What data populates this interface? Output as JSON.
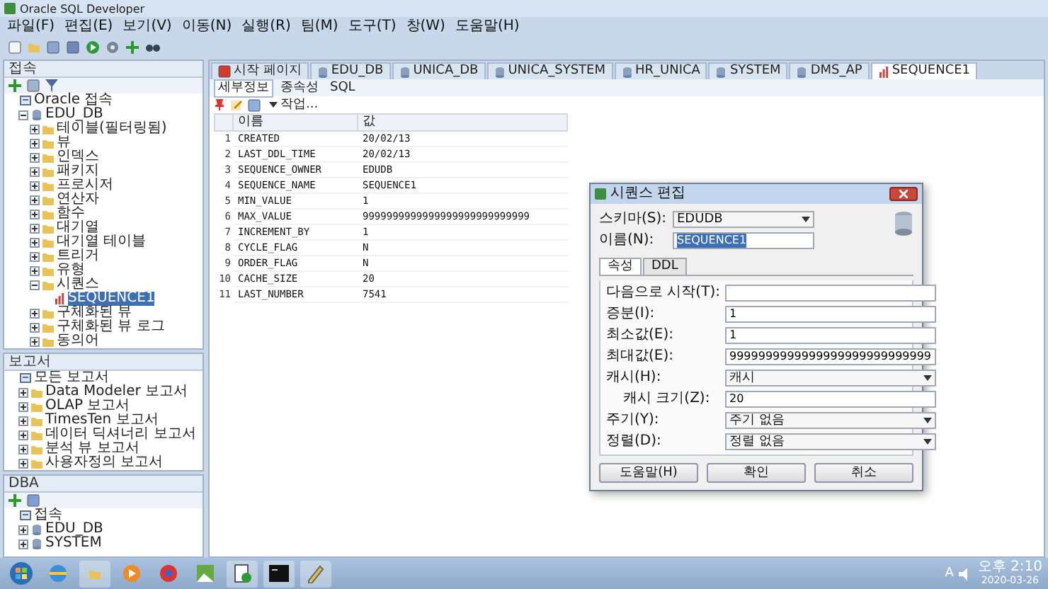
{
  "window": {
    "title": "Oracle SQL Developer"
  },
  "menu": [
    "파일(F)",
    "편집(E)",
    "보기(V)",
    "이동(N)",
    "실행(R)",
    "팀(M)",
    "도구(T)",
    "창(W)",
    "도움말(H)"
  ],
  "connections_panel": {
    "title": "접속",
    "tree": [
      {
        "label": "Oracle 접속",
        "children": [
          {
            "label": "EDU_DB",
            "expanded": true,
            "children": [
              {
                "label": "테이블(필터링됨)",
                "expanded": false
              },
              {
                "label": "뷰",
                "expanded": false
              },
              {
                "label": "인덱스",
                "expanded": false
              },
              {
                "label": "패키지",
                "expanded": false
              },
              {
                "label": "프로시저",
                "expanded": false
              },
              {
                "label": "연산자",
                "expanded": false
              },
              {
                "label": "함수",
                "expanded": false
              },
              {
                "label": "대기열",
                "expanded": false
              },
              {
                "label": "대기열 테이블",
                "expanded": false
              },
              {
                "label": "트리거",
                "expanded": false
              },
              {
                "label": "유형",
                "expanded": false
              },
              {
                "label": "시퀀스",
                "expanded": true,
                "children": [
                  {
                    "label": "SEQUENCE1",
                    "selected": true
                  }
                ]
              },
              {
                "label": "구체화된 뷰",
                "expanded": false
              },
              {
                "label": "구체화된 뷰 로그",
                "expanded": false
              },
              {
                "label": "동의어",
                "expanded": false
              }
            ]
          }
        ]
      }
    ]
  },
  "reports_panel": {
    "title": "보고서",
    "tree": [
      {
        "label": "모든 보고서",
        "children": [
          {
            "label": "Data Modeler 보고서",
            "expanded": false
          },
          {
            "label": "OLAP 보고서",
            "expanded": false
          },
          {
            "label": "TimesTen 보고서",
            "expanded": false
          },
          {
            "label": "데이터 딕셔너리 보고서",
            "expanded": false
          },
          {
            "label": "분석 뷰 보고서",
            "expanded": false
          },
          {
            "label": "사용자정의 보고서",
            "expanded": false
          }
        ]
      }
    ]
  },
  "dba_panel": {
    "title": "DBA",
    "tree": [
      {
        "label": "접속",
        "children": [
          {
            "label": "EDU_DB",
            "expanded": false
          },
          {
            "label": "SYSTEM",
            "expanded": false
          }
        ]
      }
    ]
  },
  "editor_tabs": [
    {
      "label": "시작 페이지",
      "selected": false
    },
    {
      "label": "EDU_DB",
      "selected": false
    },
    {
      "label": "UNICA_DB",
      "selected": false
    },
    {
      "label": "UNICA_SYSTEM",
      "selected": false
    },
    {
      "label": "HR_UNICA",
      "selected": false
    },
    {
      "label": "SYSTEM",
      "selected": false
    },
    {
      "label": "DMS_AP",
      "selected": false
    },
    {
      "label": "SEQUENCE1",
      "selected": true
    }
  ],
  "sub_tabs": [
    {
      "label": "세부정보",
      "selected": true
    },
    {
      "label": "종속성",
      "selected": false
    },
    {
      "label": "SQL",
      "selected": false
    }
  ],
  "actions_button": "작업...",
  "table": {
    "columns": [
      "",
      "이름",
      "값"
    ],
    "rows": [
      [
        "1",
        "CREATED",
        "20/02/13"
      ],
      [
        "2",
        "LAST_DDL_TIME",
        "20/02/13"
      ],
      [
        "3",
        "SEQUENCE_OWNER",
        "EDUDB"
      ],
      [
        "4",
        "SEQUENCE_NAME",
        "SEQUENCE1"
      ],
      [
        "5",
        "MIN_VALUE",
        "1"
      ],
      [
        "6",
        "MAX_VALUE",
        "9999999999999999999999999999"
      ],
      [
        "7",
        "INCREMENT_BY",
        "1"
      ],
      [
        "8",
        "CYCLE_FLAG",
        "N"
      ],
      [
        "9",
        "ORDER_FLAG",
        "N"
      ],
      [
        "10",
        "CACHE_SIZE",
        "20"
      ],
      [
        "11",
        "LAST_NUMBER",
        "7541"
      ]
    ]
  },
  "dialog": {
    "title": "시퀀스 편집",
    "schema_label": "스키마(S):",
    "schema_value": "EDUDB",
    "name_label": "이름(N):",
    "name_value": "SEQUENCE1",
    "tabs": [
      {
        "label": "속성",
        "selected": true
      },
      {
        "label": "DDL",
        "selected": false
      }
    ],
    "fields": [
      {
        "kind": "text",
        "label": "다음으로 시작(T):"
      },
      {
        "kind": "text",
        "label": "증분(I):",
        "value": "1"
      },
      {
        "kind": "text",
        "label": "최소값(E):",
        "value": "1"
      },
      {
        "kind": "text",
        "label": "최대값(E):",
        "value": "9999999999999999999999999999"
      },
      {
        "kind": "select",
        "label": "캐시(H):",
        "value": "캐시"
      },
      {
        "kind": "text",
        "label": "캐시 크기(Z):",
        "value": "20",
        "indented": true
      },
      {
        "kind": "select",
        "label": "주기(Y):",
        "value": "주기 없음"
      },
      {
        "kind": "select",
        "label": "정렬(D):",
        "value": "정렬 없음"
      }
    ],
    "buttons": [
      "도움말(H)",
      "확인",
      "취소"
    ]
  },
  "taskbar": {
    "tray_text": "A",
    "time": "오후 2:10",
    "date": "2020-03-26"
  }
}
